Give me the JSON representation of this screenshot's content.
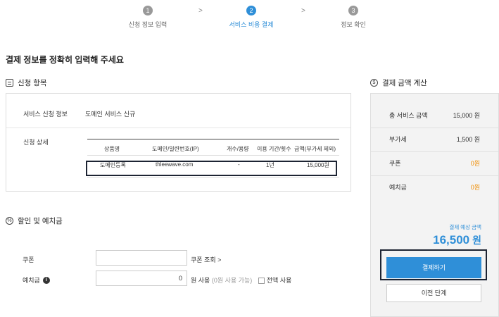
{
  "stepper": {
    "steps": [
      {
        "num": "1",
        "label": "신청 정보 입력"
      },
      {
        "num": "2",
        "label": "서비스 비용 결제"
      },
      {
        "num": "3",
        "label": "정보 확인"
      }
    ],
    "arrow": ">"
  },
  "page_title": "결제 정보를 정확히 입력해 주세요",
  "apply": {
    "section_title": "신청 항목",
    "service_info_label": "서비스 신청 정보",
    "service_info_value": "도메인 서비스 신규",
    "detail_label": "신청 상세",
    "columns": [
      "상품명",
      "도메인/일련번호(IP)",
      "개수/용량",
      "이용 기간/횟수",
      "금액(부가세 제외)"
    ],
    "row": [
      "도메인등록",
      "thleewave.com",
      "-",
      "1년",
      "15,000원"
    ]
  },
  "discount": {
    "section_title": "할인 및 예치금",
    "coupon_label": "쿠폰",
    "coupon_value": "",
    "coupon_link": "쿠폰 조회 >",
    "deposit_label": "예치금",
    "deposit_info": "i",
    "deposit_value": "0",
    "deposit_unit": "원 사용",
    "deposit_available": "(0원 사용 가능)",
    "use_all_label": "전액 사용"
  },
  "calc": {
    "section_title": "결제 금액 계산",
    "rows": [
      {
        "label": "총 서비스 금액",
        "value": "15,000 원"
      },
      {
        "label": "부가세",
        "value": "1,500 원"
      },
      {
        "label": "쿠폰",
        "value": "0원"
      },
      {
        "label": "예치금",
        "value": "0원"
      }
    ],
    "estimated_label": "결제 예상 금액",
    "estimated_total": "16,500",
    "estimated_unit": "원",
    "pay_button": "결제하기",
    "prev_button": "이전 단계"
  },
  "colors": {
    "accent": "#2f8fd8",
    "discount_value": "#f08c00",
    "highlight_border": "#1d2433"
  }
}
